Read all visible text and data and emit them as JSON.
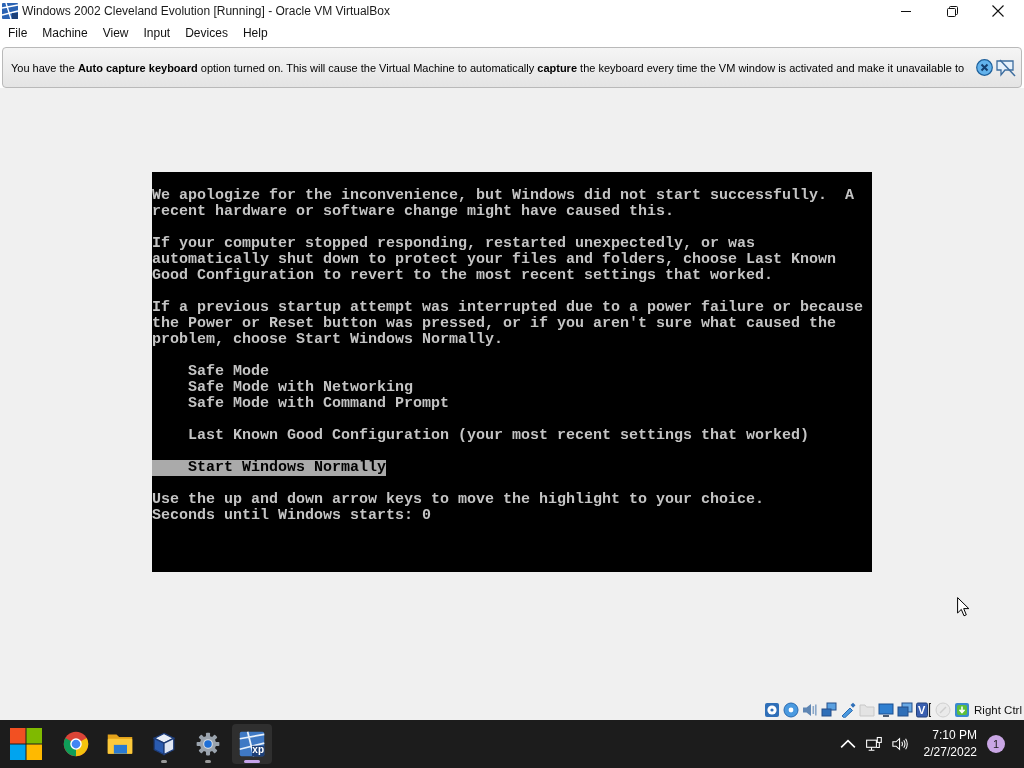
{
  "window": {
    "title": "Windows 2002 Cleveland Evolution [Running] - Oracle VM VirtualBox"
  },
  "menu_bar": [
    "File",
    "Machine",
    "View",
    "Input",
    "Devices",
    "Help"
  ],
  "notification": {
    "text": "You have the **Auto capture keyboard** option turned on. This will cause the Virtual Machine to automatically **capture** the keyboard every time the VM window is activated and make it unavailable to"
  },
  "vm_screen": {
    "paragraphs": [
      "We apologize for the inconvenience, but Windows did not start successfully.  A recent hardware or software change might have caused this.",
      "If your computer stopped responding, restarted unexpectedly, or was automatically shut down to protect your files and folders, choose Last Known Good Configuration to revert to the most recent settings that worked.",
      "If a previous startup attempt was interrupted due to a power failure or because the Power or Reset button was pressed, or if you aren't sure what caused the problem, choose Start Windows Normally."
    ],
    "option_groups": [
      [
        {
          "label": "Safe Mode",
          "selected": false
        },
        {
          "label": "Safe Mode with Networking",
          "selected": false
        },
        {
          "label": "Safe Mode with Command Prompt",
          "selected": false
        }
      ],
      [
        {
          "label": "Last Known Good Configuration (your most recent settings that worked)",
          "selected": false
        }
      ],
      [
        {
          "label": "Start Windows Normally",
          "selected": true
        }
      ]
    ],
    "instructions": [
      "Use the up and down arrow keys to move the highlight to your choice.",
      "Seconds until Windows starts: 0"
    ]
  },
  "status_bar": {
    "indicators": [
      {
        "kind": "hard-disk",
        "disabled": false
      },
      {
        "kind": "optical-disc",
        "disabled": false
      },
      {
        "kind": "audio",
        "disabled": false
      },
      {
        "kind": "network",
        "disabled": false
      },
      {
        "kind": "usb",
        "disabled": false
      },
      {
        "kind": "shared-folder",
        "disabled": true
      },
      {
        "kind": "display",
        "disabled": false
      },
      {
        "kind": "recording",
        "disabled": false
      },
      {
        "kind": "cpu",
        "disabled": false,
        "label": "V"
      },
      {
        "kind": "mouse",
        "disabled": true
      },
      {
        "kind": "keyboard",
        "disabled": false
      }
    ],
    "host_key": "Right Ctrl"
  },
  "taskbar": {
    "apps": [
      {
        "kind": "start",
        "running": false,
        "selected": false
      },
      {
        "kind": "browser",
        "running": false,
        "selected": false
      },
      {
        "kind": "folder",
        "running": false,
        "selected": false
      },
      {
        "kind": "cube",
        "running": true,
        "selected": false
      },
      {
        "kind": "settings",
        "running": true,
        "selected": false
      },
      {
        "kind": "vm",
        "running": true,
        "selected": true,
        "logo_text": "xp"
      }
    ],
    "clock": {
      "time": "7:10 PM",
      "date": "2/27/2022"
    },
    "notification_count": "1"
  }
}
